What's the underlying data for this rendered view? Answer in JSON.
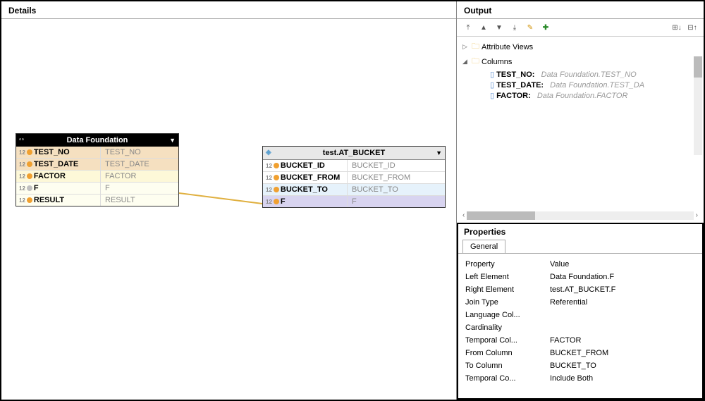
{
  "details": {
    "title": "Details",
    "node1": {
      "title": "Data Foundation",
      "rows": [
        {
          "type": "12",
          "left": "TEST_NO",
          "right": "TEST_NO",
          "bg": "bg-tan",
          "dot": "orange"
        },
        {
          "type": "12",
          "left": "TEST_DATE",
          "right": "TEST_DATE",
          "bg": "bg-tan",
          "dot": "orange"
        },
        {
          "type": "12",
          "left": "FACTOR",
          "right": "FACTOR",
          "bg": "bg-yellow",
          "dot": "orange"
        },
        {
          "type": "12",
          "left": "F",
          "right": "F",
          "bg": "bg-cream",
          "dot": "grey"
        },
        {
          "type": "12",
          "left": "RESULT",
          "right": "RESULT",
          "bg": "bg-cream",
          "dot": "orange"
        }
      ]
    },
    "node2": {
      "title": "test.AT_BUCKET",
      "rows": [
        {
          "type": "12",
          "left": "BUCKET_ID",
          "right": "BUCKET_ID",
          "bg": "",
          "dot": "orange"
        },
        {
          "type": "12",
          "left": "BUCKET_FROM",
          "right": "BUCKET_FROM",
          "bg": "",
          "dot": "orange"
        },
        {
          "type": "12",
          "left": "BUCKET_TO",
          "right": "BUCKET_TO",
          "bg": "bg-blue-lt",
          "dot": "orange"
        },
        {
          "type": "12",
          "left": "F",
          "right": "F",
          "bg": "bg-purple",
          "dot": "orange"
        }
      ]
    }
  },
  "output": {
    "title": "Output",
    "tree": {
      "item1": {
        "label": "Attribute Views"
      },
      "item2": {
        "label": "Columns",
        "children": [
          {
            "key": "TEST_NO:",
            "desc": "Data Foundation.TEST_NO"
          },
          {
            "key": "TEST_DATE:",
            "desc": "Data Foundation.TEST_DA"
          },
          {
            "key": "FACTOR:",
            "desc": "Data Foundation.FACTOR"
          }
        ]
      }
    }
  },
  "properties": {
    "title": "Properties",
    "tab": "General",
    "header_key": "Property",
    "header_val": "Value",
    "rows": [
      {
        "key": "Left Element",
        "val": "Data Foundation.F"
      },
      {
        "key": "Right Element",
        "val": "test.AT_BUCKET.F"
      },
      {
        "key": "Join Type",
        "val": "Referential"
      },
      {
        "key": "Language Col...",
        "val": ""
      },
      {
        "key": "Cardinality",
        "val": ""
      },
      {
        "key": "Temporal Col...",
        "val": "FACTOR"
      },
      {
        "key": "From Column",
        "val": "BUCKET_FROM"
      },
      {
        "key": "To Column",
        "val": "BUCKET_TO"
      },
      {
        "key": "Temporal Co...",
        "val": "Include Both"
      }
    ]
  }
}
